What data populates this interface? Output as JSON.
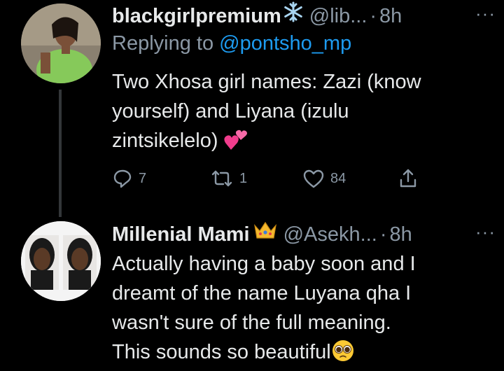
{
  "tweet1": {
    "name": "blackgirlpremium",
    "name_emoji": "snowflake-emoji",
    "handle": "@lib...",
    "dot": "·",
    "time": "8h",
    "more": "···",
    "replying_prefix": "Replying to",
    "replying_mention": "@pontsho_mp",
    "text_line1": "Two Xhosa girl names: Zazi (know",
    "text_line2": "yourself) and Liyana (izulu",
    "text_line3": "zintsikelelo)",
    "text_emoji": "two-hearts-emoji",
    "actions": {
      "reply_count": "7",
      "retweet_count": "1",
      "like_count": "84"
    }
  },
  "tweet2": {
    "name": "Millenial Mami",
    "name_emoji": "crown-emoji",
    "handle": "@Asekh...",
    "dot": "·",
    "time": "8h",
    "more": "···",
    "text_line1": "Actually having a baby soon and I",
    "text_line2": "dreamt of the name Luyana qha I",
    "text_line3": "wasn't sure of the full meaning.",
    "text_line4": "This sounds so beautiful",
    "text_emoji": "pleading-face-emoji"
  },
  "colors": {
    "background": "#000000",
    "text": "#e7e9ea",
    "secondary": "#8b98a5",
    "link": "#1d9bf0",
    "thread_line": "#333639"
  }
}
